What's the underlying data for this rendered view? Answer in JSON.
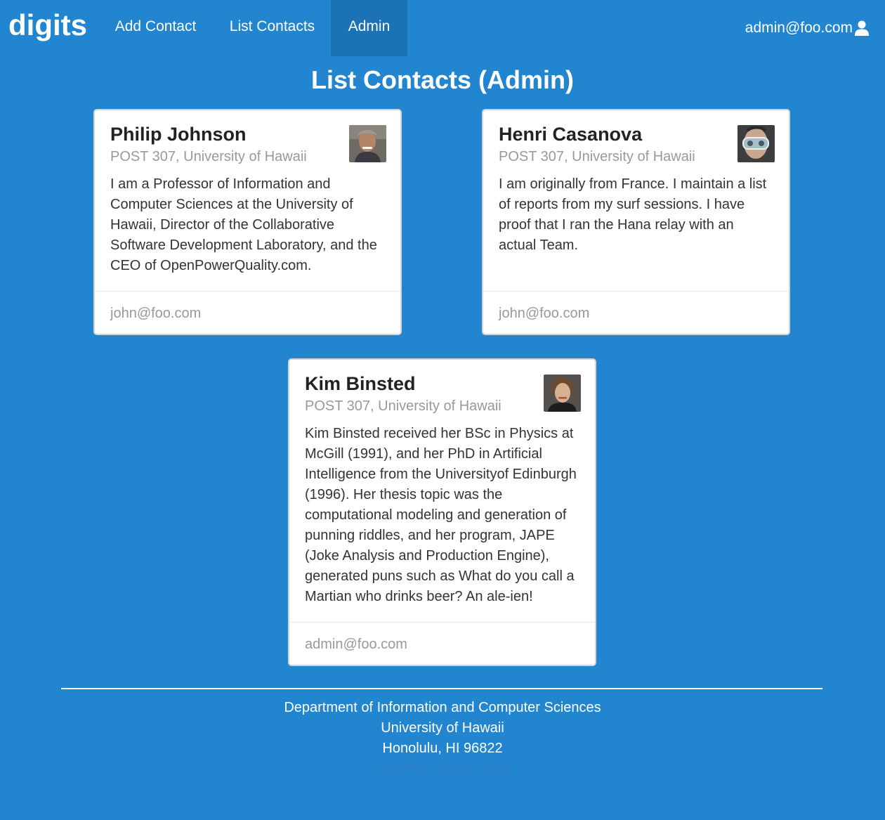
{
  "navbar": {
    "brand": "digits",
    "items": [
      {
        "label": "Add Contact"
      },
      {
        "label": "List Contacts"
      },
      {
        "label": "Admin",
        "active": true
      }
    ],
    "user": {
      "email": "admin@foo.com",
      "icon": "user-icon"
    }
  },
  "page_title": "List Contacts (Admin)",
  "contacts": [
    {
      "name": "Philip Johnson",
      "address": "POST 307, University of Hawaii",
      "description": "I am a Professor of Information and Computer Sciences at the University of Hawaii, Director of the Collaborative Software Development Laboratory, and the CEO of OpenPowerQuality.com.",
      "owner": "john@foo.com",
      "avatar": "avatar-philip-johnson"
    },
    {
      "name": "Henri Casanova",
      "address": "POST 307, University of Hawaii",
      "description": "I am originally from France. I maintain a list of reports from my surf sessions. I have proof that I ran the Hana relay with an actual Team.",
      "owner": "john@foo.com",
      "avatar": "avatar-henri-casanova"
    },
    {
      "name": "Kim Binsted",
      "address": "POST 307, University of Hawaii",
      "description": "Kim Binsted received her BSc in Physics at McGill (1991), and her PhD in Artificial Intelligence from the Universityof Edinburgh (1996). Her thesis topic was the computational modeling and generation of punning riddles, and her program, JAPE (Joke Analysis and Production Engine), generated puns such as What do you call a Martian who drinks beer? An ale-ien!",
      "owner": "admin@foo.com",
      "avatar": "avatar-kim-binsted"
    }
  ],
  "footer": {
    "line1": "Department of Information and Computer Sciences",
    "line2": "University of Hawaii",
    "line3": "Honolulu, HI 96822",
    "link": "Template Home Page"
  },
  "colors": {
    "background": "#2185d0",
    "nav_active": "#1b73b6",
    "card": "#ffffff",
    "meta_text": "#999999"
  }
}
